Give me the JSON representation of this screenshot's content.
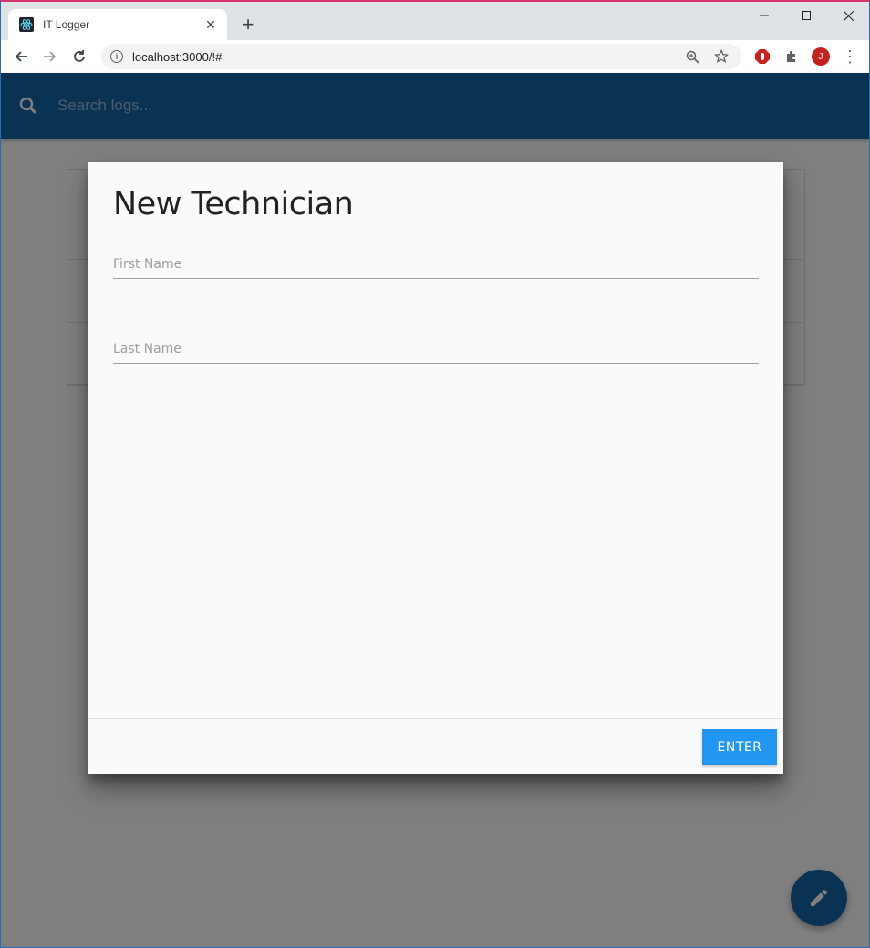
{
  "browser": {
    "tab_title": "IT Logger",
    "url": "localhost:3000/!#",
    "avatar_initial": "J"
  },
  "app": {
    "search_placeholder": "Search logs..."
  },
  "modal": {
    "title": "New Technician",
    "first_name_placeholder": "First Name",
    "last_name_placeholder": "Last Name",
    "enter_label": "ENTER"
  },
  "colors": {
    "navbar": "#1565a7",
    "enter_button": "#2196f3",
    "fab": "#1565a7"
  },
  "icons": {
    "search": "search-icon",
    "fab": "pencil-icon"
  }
}
